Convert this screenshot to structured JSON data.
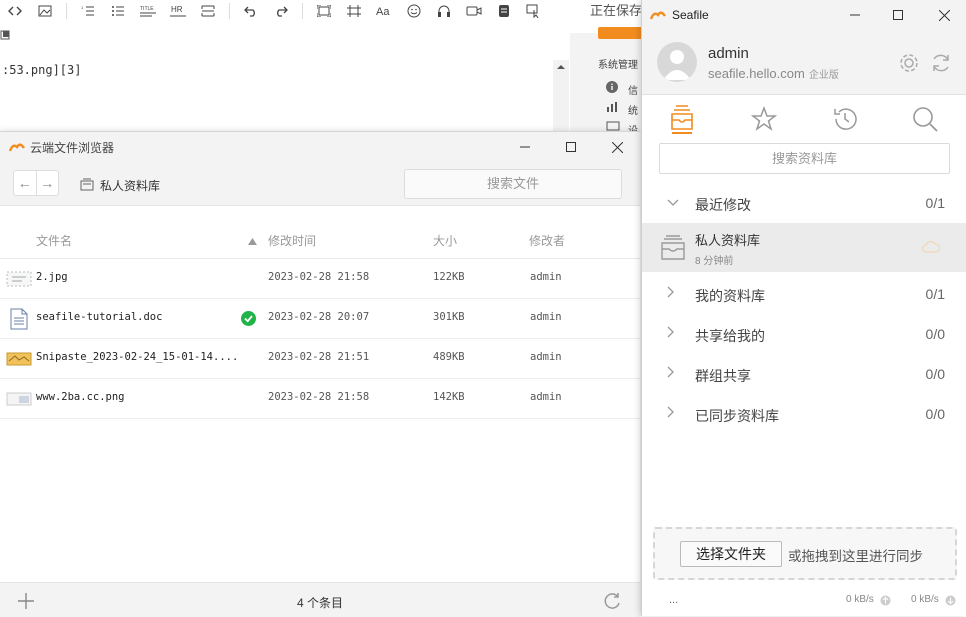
{
  "editor": {
    "saving_text": "正在保存",
    "markdown_line": ":53.png][3]",
    "admin_panel_title": "系统管理",
    "admin_items": [
      "信",
      "统",
      "设"
    ],
    "toolbar_icons": [
      "code-icon",
      "image-icon",
      "ordered-list-icon",
      "unordered-list-icon",
      "title-icon",
      "hr-icon",
      "page-break-icon",
      "undo-icon",
      "redo-icon",
      "fullscreen-icon",
      "fit-icon",
      "font-icon",
      "emoji-icon",
      "headphones-icon",
      "video-icon",
      "note-icon",
      "cursor-icon"
    ],
    "toolbar_labels": {
      "title": "TITLE",
      "hr": "HR",
      "font": "Aa"
    }
  },
  "browser": {
    "title": "云端文件浏览器",
    "breadcrumb": "私人资料库",
    "search_placeholder": "搜索文件",
    "columns": {
      "name": "文件名",
      "mtime": "修改时间",
      "size": "大小",
      "modifier": "修改者"
    },
    "files": [
      {
        "name": "2.jpg",
        "mtime": "2023-02-28 21:58",
        "size": "122KB",
        "modifier": "admin",
        "icon": "image-thumb-icon",
        "synced": false
      },
      {
        "name": "seafile-tutorial.doc",
        "mtime": "2023-02-28 20:07",
        "size": "301KB",
        "modifier": "admin",
        "icon": "document-icon",
        "synced": true
      },
      {
        "name": "Snipaste_2023-02-24_15-01-14....",
        "mtime": "2023-02-28 21:51",
        "size": "489KB",
        "modifier": "admin",
        "icon": "image-thumb-icon",
        "synced": false
      },
      {
        "name": "www.2ba.cc.png",
        "mtime": "2023-02-28 21:58",
        "size": "142KB",
        "modifier": "admin",
        "icon": "image-thumb-icon",
        "synced": false
      }
    ],
    "item_count": "4 个条目"
  },
  "seafile": {
    "title": "Seafile",
    "account": {
      "name": "admin",
      "server": "seafile.hello.com",
      "edition": "企业版"
    },
    "search_placeholder": "搜索资料库",
    "categories": [
      {
        "label": "最近修改",
        "count": "0/1",
        "expanded": true
      },
      {
        "label": "我的资料库",
        "count": "0/1",
        "expanded": false
      },
      {
        "label": "共享给我的",
        "count": "0/0",
        "expanded": false
      },
      {
        "label": "群组共享",
        "count": "0/0",
        "expanded": false
      },
      {
        "label": "已同步资料库",
        "count": "0/0",
        "expanded": false
      }
    ],
    "repo": {
      "name": "私人资料库",
      "time": "8 分钟前"
    },
    "choose_folder": "选择文件夹",
    "drop_hint": "或拖拽到这里进行同步",
    "status": {
      "dots": "...",
      "upload_rate": "0 kB/s",
      "download_rate": "0 kB/s"
    },
    "accent": "#f28c1e"
  }
}
